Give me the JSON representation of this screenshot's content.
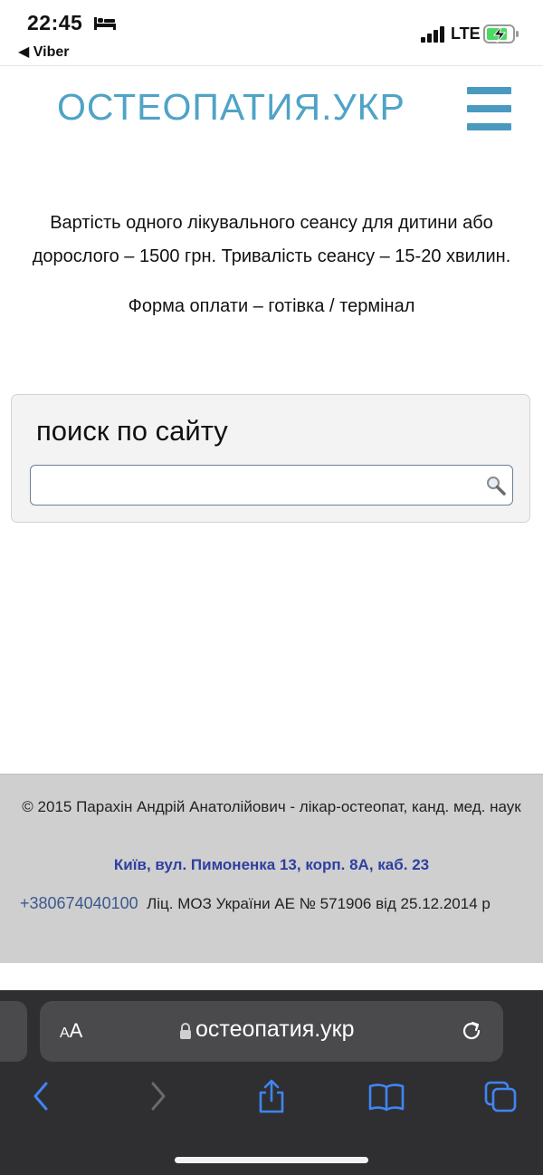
{
  "status_bar": {
    "time": "22:45",
    "back_app": "◀ Viber",
    "network": "LTE"
  },
  "site": {
    "logo": "ОСТЕОПАТИЯ.УКР",
    "price_text": "Вартість одного лікувального сеансу для дитини або дорослого – 1500 грн. Тривалість сеансу – 15-20 хвилин.",
    "payment_text": "Форма оплати – готівка / термінал",
    "search": {
      "title": "поиск по сайту",
      "value": "",
      "placeholder": ""
    },
    "footer": {
      "copyright": "© 2015 Парахін Андрій Анатолійович - лікар-остеопат, канд. мед. наук",
      "address": "Київ, вул. Пимоненка 13, корп. 8А, каб. 23",
      "phone": "+380674040100",
      "license": "Ліц. МОЗ України АЕ № 571906 від 25.12.2014 р"
    }
  },
  "browser": {
    "text_size_small": "A",
    "text_size_large": "A",
    "url": "остеопатия.укр"
  },
  "colors": {
    "logo": "#4fa3c6",
    "hamburger": "#4a9ac0",
    "address": "#2f3fa0",
    "safari_accent": "#3e86f5"
  }
}
